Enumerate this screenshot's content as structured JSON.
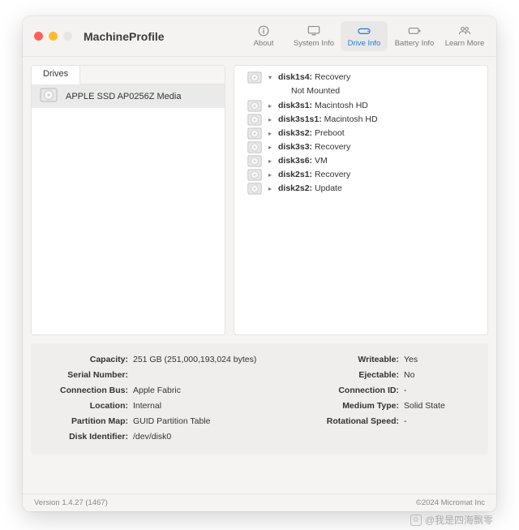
{
  "app": {
    "title": "MachineProfile"
  },
  "toolbar": {
    "about": "About",
    "system": "System Info",
    "drive": "Drive Info",
    "battery": "Battery Info",
    "learn": "Learn More"
  },
  "left": {
    "tab": "Drives",
    "item": "APPLE SSD AP0256Z Media"
  },
  "volumes": [
    {
      "expanded": true,
      "name": "disk1s4:",
      "desc": "Recovery",
      "sub": "Not Mounted"
    },
    {
      "expanded": false,
      "name": "disk3s1:",
      "desc": "Macintosh HD"
    },
    {
      "expanded": false,
      "name": "disk3s1s1:",
      "desc": "Macintosh HD"
    },
    {
      "expanded": false,
      "name": "disk3s2:",
      "desc": "Preboot"
    },
    {
      "expanded": false,
      "name": "disk3s3:",
      "desc": "Recovery"
    },
    {
      "expanded": false,
      "name": "disk3s6:",
      "desc": "VM"
    },
    {
      "expanded": false,
      "name": "disk2s1:",
      "desc": "Recovery"
    },
    {
      "expanded": false,
      "name": "disk2s2:",
      "desc": "Update"
    }
  ],
  "details": {
    "left": [
      {
        "label": "Capacity:",
        "value": "251 GB (251,000,193,024 bytes)"
      },
      {
        "label": "Serial Number:",
        "value": ""
      },
      {
        "label": "Connection Bus:",
        "value": "Apple Fabric"
      },
      {
        "label": "Location:",
        "value": "Internal"
      },
      {
        "label": "Partition Map:",
        "value": "GUID Partition Table"
      },
      {
        "label": "Disk Identifier:",
        "value": "/dev/disk0"
      }
    ],
    "right": [
      {
        "label": "Writeable:",
        "value": "Yes"
      },
      {
        "label": "Ejectable:",
        "value": "No"
      },
      {
        "label": "Connection ID:",
        "value": "-"
      },
      {
        "label": "Medium Type:",
        "value": "Solid State"
      },
      {
        "label": "Rotational Speed:",
        "value": "-"
      }
    ]
  },
  "footer": {
    "version": "Version 1.4.27 (1467)",
    "copyright": "©2024 Micromat Inc"
  },
  "watermark": "@我是四海飘零"
}
